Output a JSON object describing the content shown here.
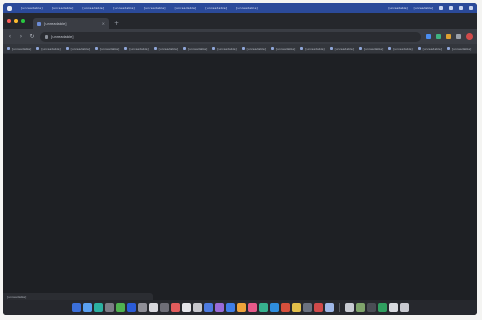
{
  "window": {
    "tab_title": "[unreadable]",
    "tab_close_glyph": "×",
    "new_tab_glyph": "+",
    "address_url": "[unreadable]"
  },
  "menubar": {
    "items": [
      "[unreadable]",
      "[unreadable]",
      "[unreadable]",
      "[unreadable]",
      "[unreadable]",
      "[unreadable]",
      "[unreadable]",
      "[unreadable]"
    ],
    "status_texts": [
      "[unreadable]",
      "[unreadable]"
    ]
  },
  "toolbar": {
    "back_glyph": "‹",
    "forward_glyph": "›",
    "reload_glyph": "↻"
  },
  "bookmarks": [
    {
      "label": "[unreadable]"
    },
    {
      "label": "[unreadable]"
    },
    {
      "label": "[unreadable]"
    },
    {
      "label": "[unreadable]"
    },
    {
      "label": "[unreadable]"
    },
    {
      "label": "[unreadable]"
    },
    {
      "label": "[unreadable]"
    },
    {
      "label": "[unreadable]"
    },
    {
      "label": "[unreadable]"
    },
    {
      "label": "[unreadable]"
    },
    {
      "label": "[unreadable]"
    },
    {
      "label": "[unreadable]"
    },
    {
      "label": "[unreadable]"
    },
    {
      "label": "[unreadable]"
    },
    {
      "label": "[unreadable]"
    },
    {
      "label": "[unreadable]"
    }
  ],
  "statusbar": {
    "text": "[unreadable]"
  },
  "colors": {
    "traffic": [
      "#ff5f57",
      "#febc2e",
      "#28c840"
    ],
    "extensions": [
      "#4a8df0",
      "#3fb27f",
      "#e0a030",
      "#d04a4a"
    ],
    "dock_apps": [
      "#3b6fd8",
      "#5aa0f0",
      "#2bb0a0",
      "#7c7c85",
      "#4fb24f",
      "#2a5bd7",
      "#8e8e96",
      "#d9d9de",
      "#6f6f78",
      "#e35d5d",
      "#e6e6ea",
      "#c7c7cc",
      "#4d7be0",
      "#9a6bd8",
      "#3f7ee8",
      "#f0a43a",
      "#e85a8a",
      "#37b38f",
      "#2f8fe0",
      "#d8503c",
      "#e3c04a",
      "#6b7280",
      "#d04a4a",
      "#9fb8e8",
      "#c9ccd3",
      "#7fa46b",
      "#4a4d55",
      "#30a060",
      "#d9dbe0",
      "#c8cad0"
    ]
  }
}
